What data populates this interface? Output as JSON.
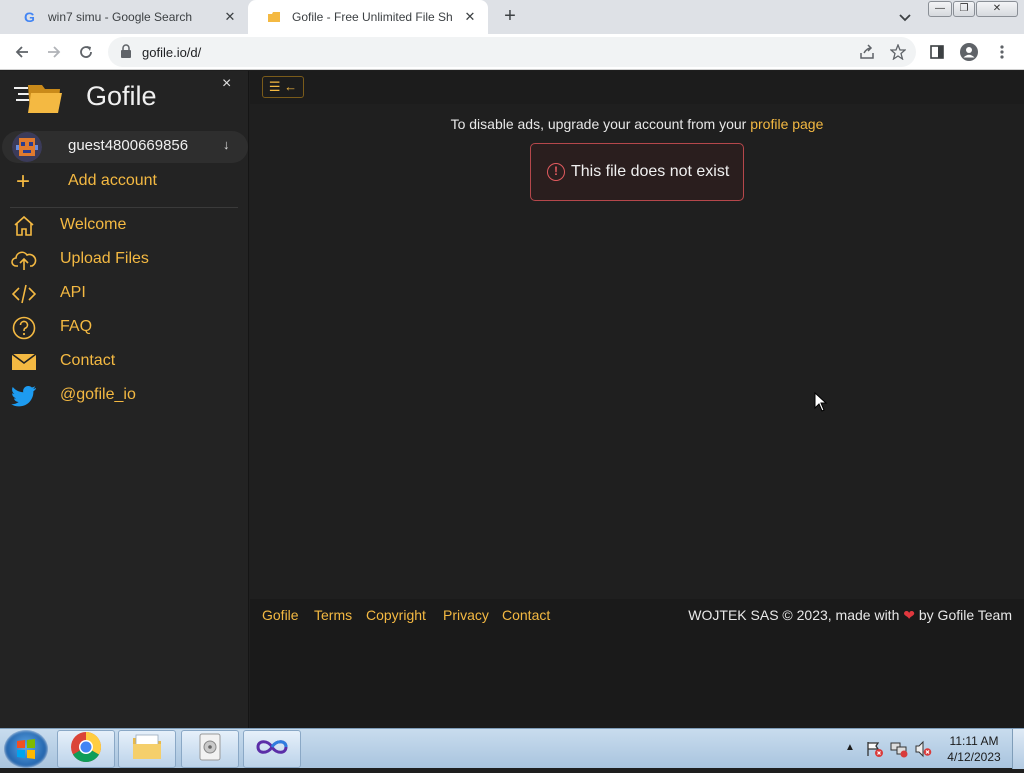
{
  "browser": {
    "tabs": [
      {
        "title": "win7 simu - Google Search",
        "icon": "google-icon",
        "active": false
      },
      {
        "title": "Gofile - Free Unlimited File Sharing",
        "icon": "gofile-icon",
        "active": true
      }
    ],
    "url": "gofile.io/d/",
    "colors": {
      "tabbar": "#dee1e6",
      "toolbar": "#ffffff"
    }
  },
  "sidebar": {
    "brand": "Gofile",
    "close_label": "×",
    "account": {
      "name": "guest4800669856",
      "arrow": "↓"
    },
    "add_account_label": "Add account",
    "items": [
      {
        "label": "Welcome",
        "icon": "home-icon"
      },
      {
        "label": "Upload Files",
        "icon": "cloud-upload-icon"
      },
      {
        "label": "API",
        "icon": "code-icon"
      },
      {
        "label": "FAQ",
        "icon": "question-circle-icon"
      },
      {
        "label": "Contact",
        "icon": "envelope-icon"
      },
      {
        "label": "@gofile_io",
        "icon": "twitter-icon"
      }
    ]
  },
  "main": {
    "toggle_label": "☰ ←",
    "ads_text": "To disable ads, upgrade your account from your",
    "ads_link": "profile page",
    "alert_icon": "!",
    "alert_text": "This file does not exist"
  },
  "footer": {
    "links": [
      "Gofile",
      "Terms",
      "Copyright",
      "Privacy",
      "Contact"
    ],
    "copyright_prefix": "WOJTEK SAS © 2023, made with",
    "heart": "❤",
    "copyright_suffix": "by Gofile Team"
  },
  "taskbar": {
    "time": "11:11 AM",
    "date": "4/12/2023",
    "apps": [
      "chrome-icon",
      "file-explorer-icon",
      "media-icon",
      "infinity-icon"
    ]
  },
  "colors": {
    "accent": "#f4b942",
    "page_bg": "#1f1f1f",
    "sidebar_bg": "#232323",
    "alert_border": "#b5474b"
  }
}
